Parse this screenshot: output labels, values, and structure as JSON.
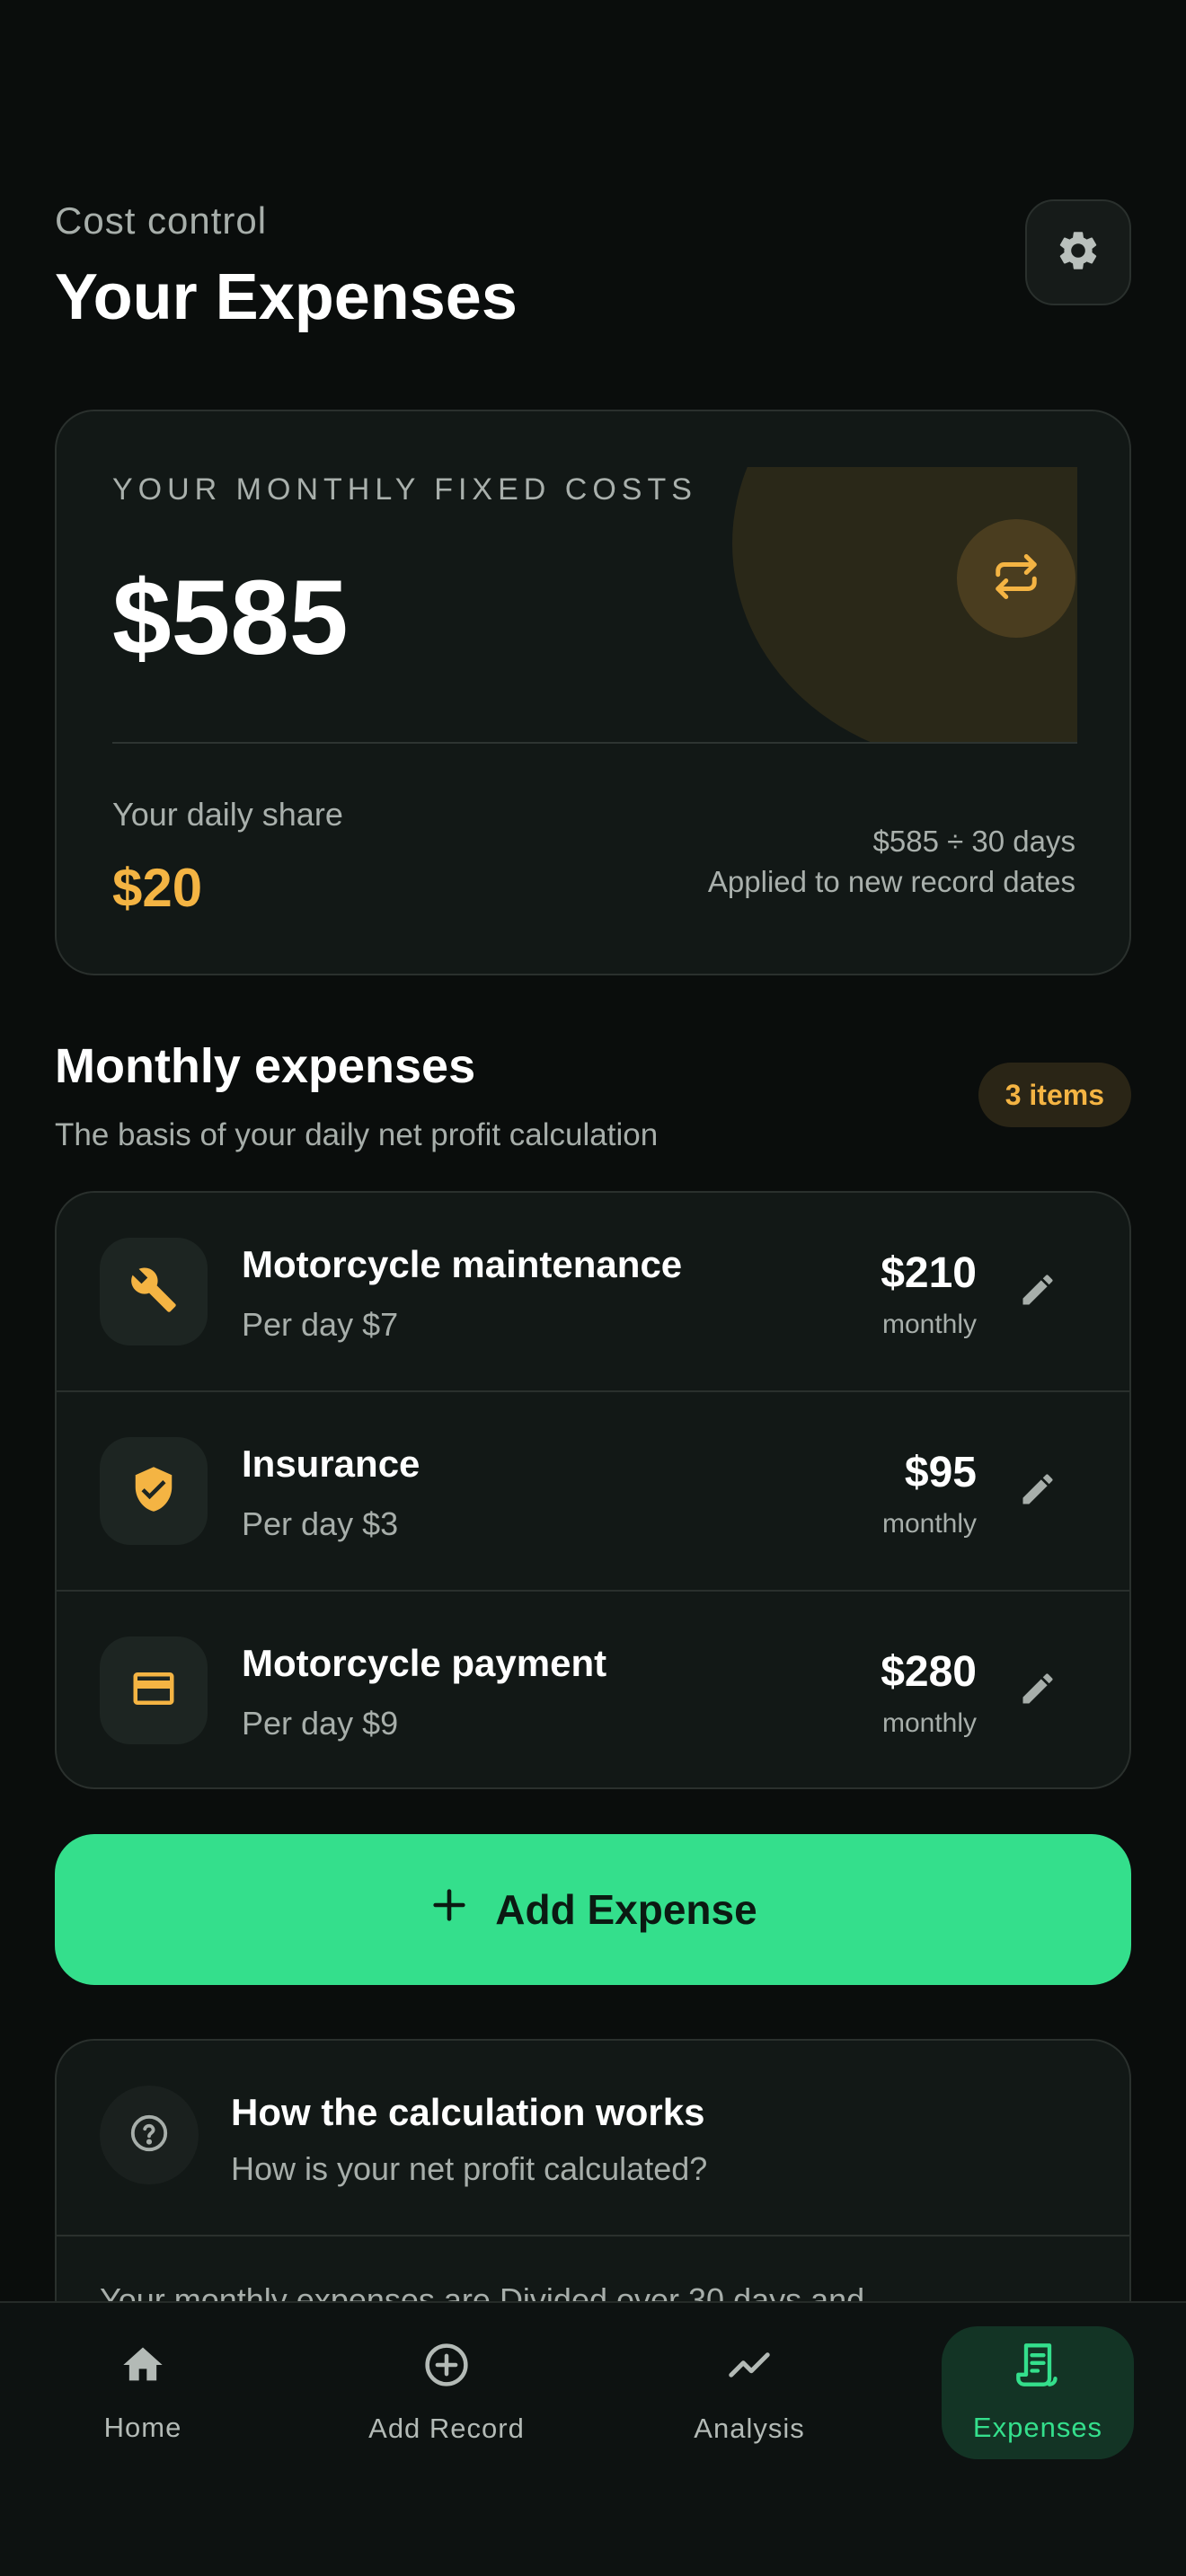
{
  "header": {
    "subtitle": "Cost control",
    "title": "Your Expenses"
  },
  "summary": {
    "label": "YOUR MONTHLY FIXED COSTS",
    "total": "$585",
    "daily_label": "Your daily share",
    "daily_value": "$20",
    "formula": "$585 ÷ 30 days",
    "note": "Applied to new record dates"
  },
  "section": {
    "title": "Monthly expenses",
    "subtitle": "The basis of your daily net profit calculation",
    "count": "3 items"
  },
  "expenses": [
    {
      "name": "Motorcycle maintenance",
      "per_day": "Per day $7",
      "amount": "$210",
      "period": "monthly",
      "icon": "wrench-icon"
    },
    {
      "name": "Insurance",
      "per_day": "Per day $3",
      "amount": "$95",
      "period": "monthly",
      "icon": "shield-check-icon"
    },
    {
      "name": "Motorcycle payment",
      "per_day": "Per day $9",
      "amount": "$280",
      "period": "monthly",
      "icon": "credit-card-icon"
    }
  ],
  "add_button": {
    "label": "Add Expense"
  },
  "how": {
    "title": "How the calculation works",
    "subtitle": "How is your net profit calculated?",
    "body": "Your monthly expenses are Divided over 30 days and"
  },
  "nav": [
    {
      "label": "Home",
      "icon": "home-icon"
    },
    {
      "label": "Add Record",
      "icon": "add-circle-icon"
    },
    {
      "label": "Analysis",
      "icon": "trend-icon"
    },
    {
      "label": "Expenses",
      "icon": "receipt-icon",
      "active": true
    }
  ],
  "colors": {
    "background": "#0a0d0c",
    "card": "#121816",
    "accent_green": "#34df8c",
    "accent_amber": "#f4b443"
  }
}
